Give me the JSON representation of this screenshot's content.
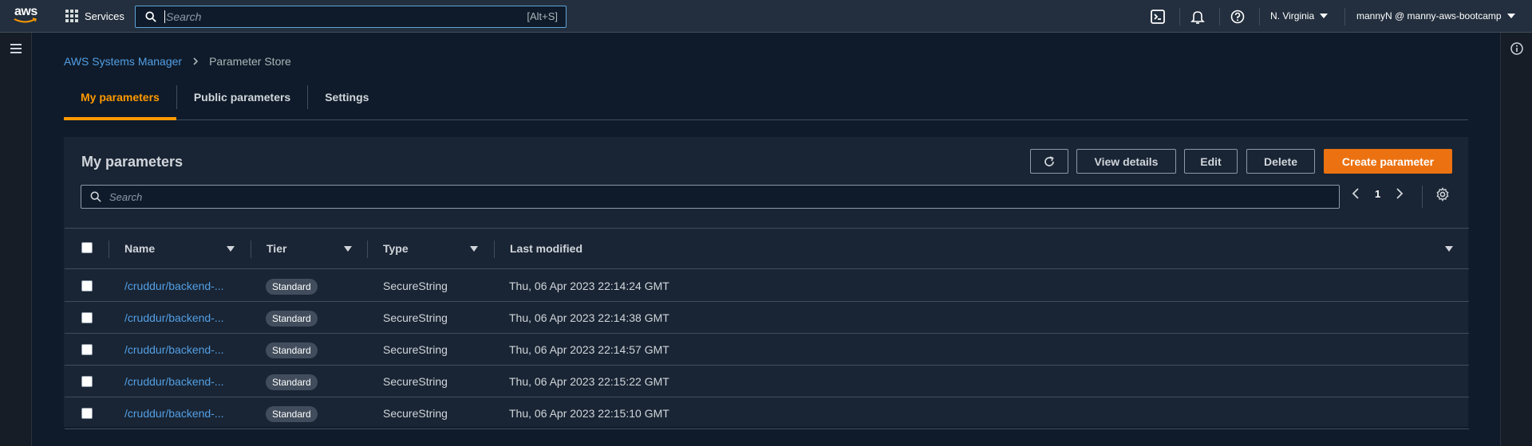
{
  "topnav": {
    "logo_text": "aws",
    "services_label": "Services",
    "search_placeholder": "Search",
    "search_shortcut": "[Alt+S]",
    "region": "N. Virginia",
    "account": "mannyN @ manny-aws-bootcamp"
  },
  "breadcrumb": {
    "parent": "AWS Systems Manager",
    "current": "Parameter Store"
  },
  "tabs": [
    {
      "label": "My parameters",
      "active": true
    },
    {
      "label": "Public parameters",
      "active": false
    },
    {
      "label": "Settings",
      "active": false
    }
  ],
  "container": {
    "title": "My parameters",
    "buttons": {
      "view_details": "View details",
      "edit": "Edit",
      "delete": "Delete",
      "create": "Create parameter"
    },
    "filter_placeholder": "Search",
    "page_number": "1"
  },
  "table": {
    "columns": [
      "Name",
      "Tier",
      "Type",
      "Last modified"
    ],
    "rows": [
      {
        "name": "/cruddur/backend-...",
        "tier": "Standard",
        "type": "SecureString",
        "last_modified": "Thu, 06 Apr 2023 22:14:24 GMT"
      },
      {
        "name": "/cruddur/backend-...",
        "tier": "Standard",
        "type": "SecureString",
        "last_modified": "Thu, 06 Apr 2023 22:14:38 GMT"
      },
      {
        "name": "/cruddur/backend-...",
        "tier": "Standard",
        "type": "SecureString",
        "last_modified": "Thu, 06 Apr 2023 22:14:57 GMT"
      },
      {
        "name": "/cruddur/backend-...",
        "tier": "Standard",
        "type": "SecureString",
        "last_modified": "Thu, 06 Apr 2023 22:15:22 GMT"
      },
      {
        "name": "/cruddur/backend-...",
        "tier": "Standard",
        "type": "SecureString",
        "last_modified": "Thu, 06 Apr 2023 22:15:10 GMT"
      }
    ]
  },
  "colors": {
    "accent": "#ff9900",
    "primary_button": "#ec7211",
    "link": "#539fe5",
    "background": "#0f1b2a",
    "container": "#192534"
  },
  "icons": [
    "aws-logo",
    "services-grid-icon",
    "search-icon",
    "cloudshell-icon",
    "bell-icon",
    "help-icon",
    "hamburger-icon",
    "info-icon",
    "refresh-icon",
    "chevron-left-icon",
    "chevron-right-icon",
    "settings-gear-icon",
    "sort-caret-icon"
  ]
}
